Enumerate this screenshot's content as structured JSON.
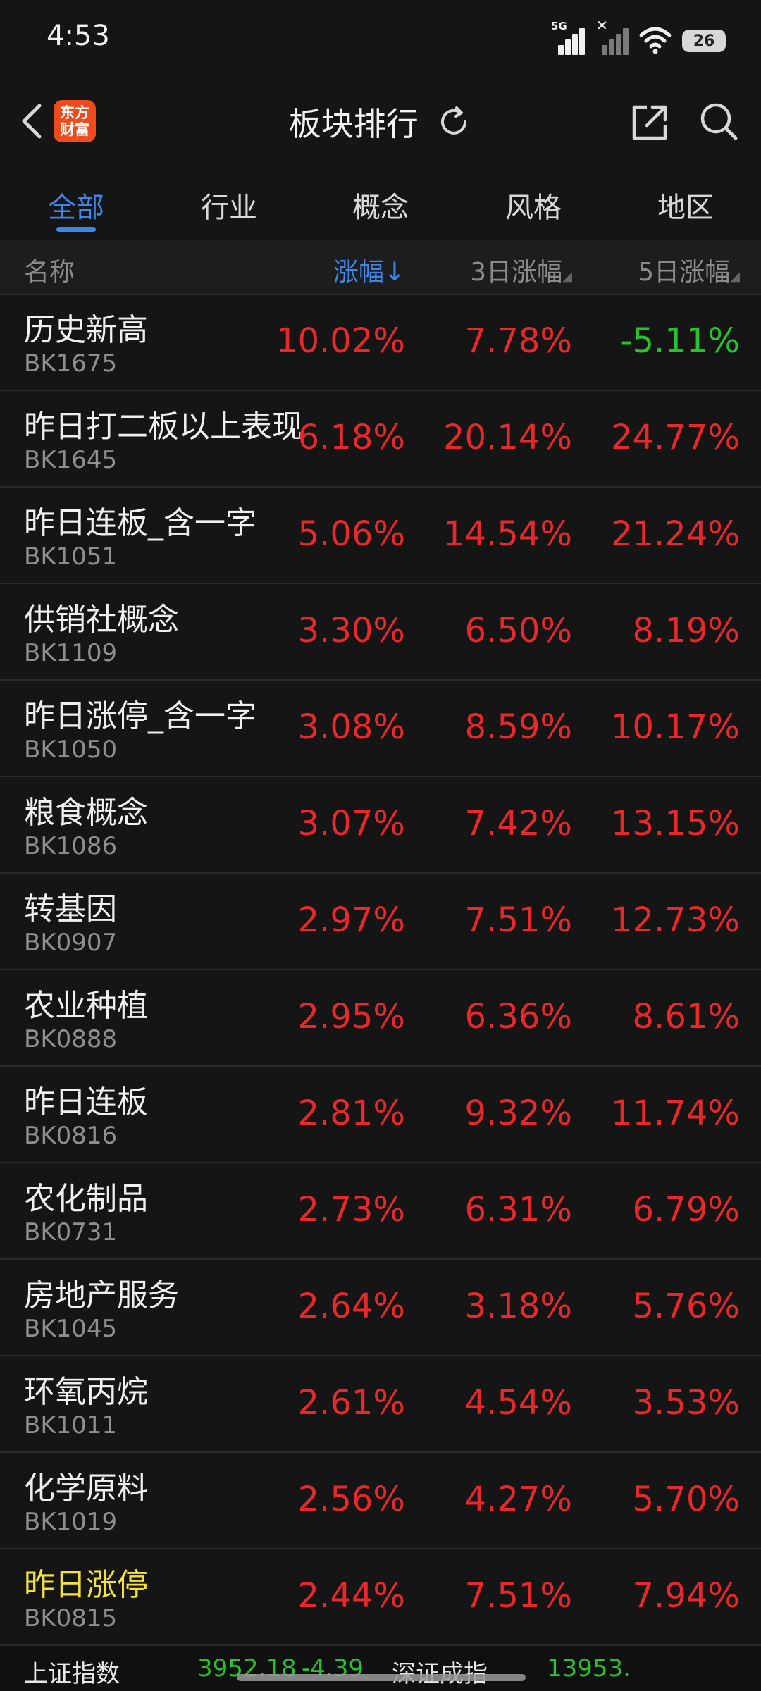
{
  "status_bar": {
    "time": "4:53",
    "network_label": "5G",
    "battery": "26"
  },
  "header": {
    "logo_line1": "东方",
    "logo_line2": "财富",
    "title": "板块排行",
    "icons": [
      "back-icon",
      "refresh-icon",
      "share-icon",
      "search-icon"
    ]
  },
  "tabs": [
    {
      "label": "全部",
      "active": true
    },
    {
      "label": "行业",
      "active": false
    },
    {
      "label": "概念",
      "active": false
    },
    {
      "label": "风格",
      "active": false
    },
    {
      "label": "地区",
      "active": false
    }
  ],
  "columns": {
    "name": "名称",
    "change": "涨幅",
    "change_sort_arrow": "↓",
    "change_3d": "3日涨幅",
    "change_5d": "5日涨幅"
  },
  "rows": [
    {
      "name": "历史新高",
      "code": "BK1675",
      "change": "10.02%",
      "change_3d": "7.78%",
      "change_5d": "-5.11%"
    },
    {
      "name": "昨日打二板以上表现",
      "code": "BK1645",
      "change": "6.18%",
      "change_3d": "20.14%",
      "change_5d": "24.77%"
    },
    {
      "name": "昨日连板_含一字",
      "code": "BK1051",
      "change": "5.06%",
      "change_3d": "14.54%",
      "change_5d": "21.24%"
    },
    {
      "name": "供销社概念",
      "code": "BK1109",
      "change": "3.30%",
      "change_3d": "6.50%",
      "change_5d": "8.19%"
    },
    {
      "name": "昨日涨停_含一字",
      "code": "BK1050",
      "change": "3.08%",
      "change_3d": "8.59%",
      "change_5d": "10.17%"
    },
    {
      "name": "粮食概念",
      "code": "BK1086",
      "change": "3.07%",
      "change_3d": "7.42%",
      "change_5d": "13.15%"
    },
    {
      "name": "转基因",
      "code": "BK0907",
      "change": "2.97%",
      "change_3d": "7.51%",
      "change_5d": "12.73%"
    },
    {
      "name": "农业种植",
      "code": "BK0888",
      "change": "2.95%",
      "change_3d": "6.36%",
      "change_5d": "8.61%"
    },
    {
      "name": "昨日连板",
      "code": "BK0816",
      "change": "2.81%",
      "change_3d": "9.32%",
      "change_5d": "11.74%"
    },
    {
      "name": "农化制品",
      "code": "BK0731",
      "change": "2.73%",
      "change_3d": "6.31%",
      "change_5d": "6.79%"
    },
    {
      "name": "房地产服务",
      "code": "BK1045",
      "change": "2.64%",
      "change_3d": "3.18%",
      "change_5d": "5.76%"
    },
    {
      "name": "环氧丙烷",
      "code": "BK1011",
      "change": "2.61%",
      "change_3d": "4.54%",
      "change_5d": "3.53%"
    },
    {
      "name": "化学原料",
      "code": "BK1019",
      "change": "2.56%",
      "change_3d": "4.27%",
      "change_5d": "5.70%"
    },
    {
      "name": "昨日涨停",
      "code": "BK0815",
      "change": "2.44%",
      "change_3d": "7.51%",
      "change_5d": "7.94%",
      "highlight": true
    }
  ],
  "ticker": {
    "index1_name": "上证指数",
    "index1_value": "3952.18",
    "index1_change": "-4.39",
    "index2_name": "深证成指",
    "index2_value": "13953."
  },
  "colors": {
    "up": "#e8282a",
    "down": "#27c22c",
    "accent": "#3d86e6",
    "highlight": "#f5e238",
    "background": "#151515"
  }
}
